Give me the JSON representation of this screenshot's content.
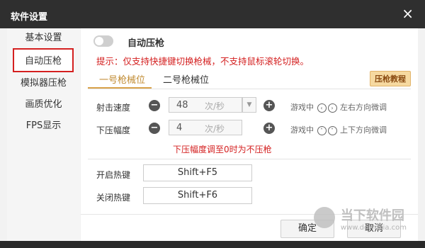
{
  "window": {
    "title": "软件设置",
    "close_symbol": "×"
  },
  "sidebar": {
    "items": [
      {
        "label": "基本设置"
      },
      {
        "label": "自动压枪"
      },
      {
        "label": "模拟器压枪"
      },
      {
        "label": "画质优化"
      },
      {
        "label": "FPS显示"
      }
    ],
    "active_index": 1
  },
  "main": {
    "toggle": {
      "label": "自动压枪",
      "enabled": false
    },
    "hint": "提示：仅支持快捷键切换枪械，不支持鼠标滚轮切换。",
    "tabs": [
      {
        "label": "一号枪械位"
      },
      {
        "label": "二号枪械位"
      }
    ],
    "active_tab": 0,
    "tutorial_button": "压枪教程",
    "fire_speed": {
      "label": "射击速度",
      "value": "48",
      "unit": "次/秒",
      "minus": "−",
      "plus": "+",
      "tip_pre": "游戏中",
      "tip_post": "左右方向微调"
    },
    "press_amount": {
      "label": "下压幅度",
      "value": "4",
      "unit": "次/秒",
      "minus": "−",
      "plus": "+",
      "tip_pre": "游戏中",
      "tip_post": "上下方向微调"
    },
    "warning": "下压幅度调至0时为不压枪",
    "hotkeys": {
      "open": {
        "label": "开启热键",
        "value": "Shift+F5"
      },
      "close": {
        "label": "关闭热键",
        "value": "Shift+F6"
      }
    },
    "buttons": {
      "ok": "确定",
      "cancel": "取消"
    }
  },
  "watermark": {
    "title": "当下软件园",
    "url": "www.downxia.com"
  },
  "colors": {
    "accent_red": "#d42020",
    "tab_gold": "#d9a24a",
    "titlebar": "#2f2f2f"
  }
}
